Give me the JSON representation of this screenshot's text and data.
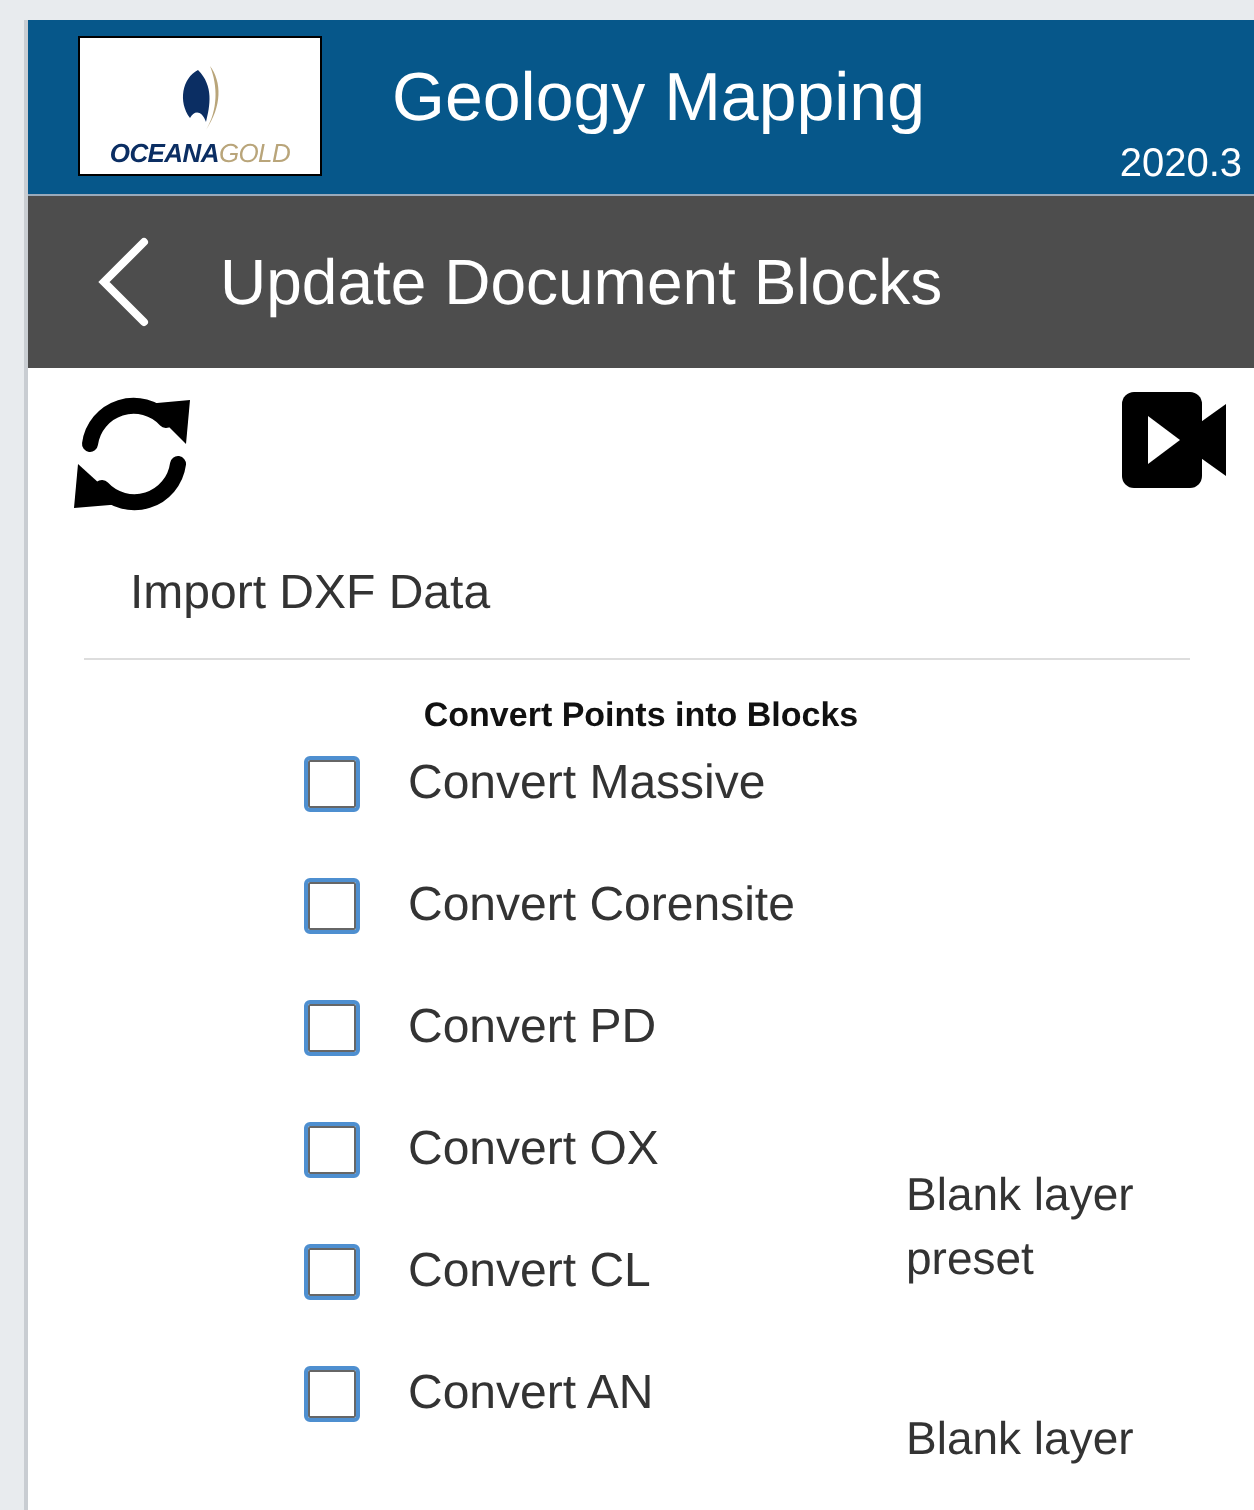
{
  "header": {
    "logo": {
      "brand_first": "OCEANA",
      "brand_second": "GOLD"
    },
    "title": "Geology Mapping",
    "version": "2020.3"
  },
  "navbar": {
    "title": "Update Document Blocks"
  },
  "import_label": "Import DXF Data",
  "section_heading": "Convert Points into Blocks",
  "options": [
    {
      "label": "Convert Massive",
      "checked": false
    },
    {
      "label": "Convert Corensite",
      "checked": false
    },
    {
      "label": "Convert PD",
      "checked": false
    },
    {
      "label": "Convert OX",
      "checked": false,
      "note": "Blank layer preset"
    },
    {
      "label": "Convert CL",
      "checked": false
    },
    {
      "label": "Convert AN",
      "checked": false,
      "note": "Blank layer"
    }
  ]
}
